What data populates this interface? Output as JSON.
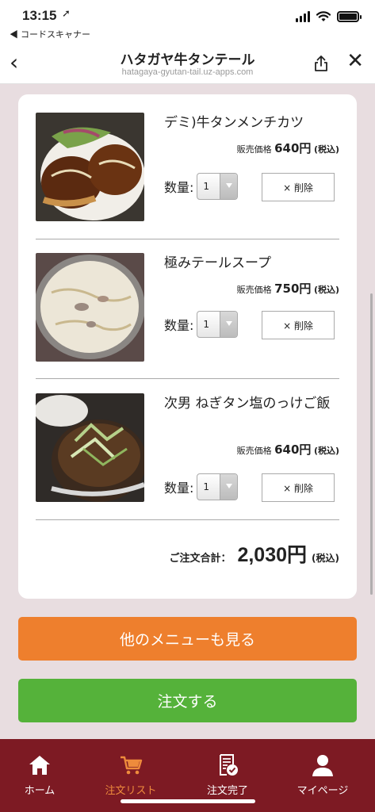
{
  "status_bar": {
    "time": "13:15",
    "back_app": "◀ コードスキャナー"
  },
  "nav": {
    "title": "ハタガヤ牛タンテール",
    "url": "hatagaya-gyutan-tail.uz-apps.com"
  },
  "cart": {
    "price_label": "販売価格",
    "tax_label": "(税込)",
    "qty_label": "数量:",
    "delete_label": "× 削除",
    "items": [
      {
        "name": "デミ)牛タンメンチカツ",
        "price": "640円",
        "qty": "1"
      },
      {
        "name": "極みテールスープ",
        "price": "750円",
        "qty": "1"
      },
      {
        "name": "次男 ねぎタン塩のっけご飯",
        "price": "640円",
        "qty": "1"
      }
    ],
    "total_label": "ご注文合計：",
    "total_value": "2,030円",
    "total_tax": "(税込)"
  },
  "buttons": {
    "more_menu": "他のメニューも見る",
    "order": "注文する"
  },
  "tabs": [
    {
      "label": "ホーム",
      "icon": "home-icon"
    },
    {
      "label": "注文リスト",
      "icon": "cart-icon",
      "active": true
    },
    {
      "label": "注文完了",
      "icon": "receipt-check-icon"
    },
    {
      "label": "マイページ",
      "icon": "user-icon"
    }
  ],
  "colors": {
    "orange": "#ee7f2d",
    "green": "#55b23a",
    "tab_bar": "#7d1a23",
    "active_tab": "#ee8b3c"
  }
}
